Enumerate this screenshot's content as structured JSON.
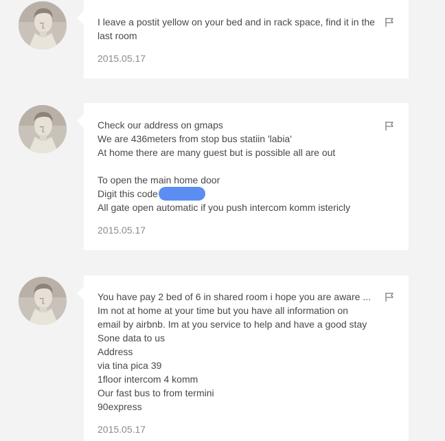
{
  "messages": [
    {
      "lines": [
        "I leave a postit yellow on your bed and in rack space, find it in the last room"
      ],
      "date": "2015.05.17",
      "flag_icon": "flag-icon",
      "avatar_icon": "avatar-david-statue"
    },
    {
      "lines": [
        "Check our address on gmaps",
        "We are 436meters from stop bus statiin 'labia'",
        "At home there are many guest but is possible all are out",
        "",
        "To open the main home door",
        "Digit this code",
        "All gate open automatic if you push intercom komm istericly"
      ],
      "date": "2015.05.17",
      "flag_icon": "flag-icon",
      "avatar_icon": "avatar-david-statue"
    },
    {
      "lines": [
        "You have pay 2 bed of 6 in shared room i hope you are aware ...",
        "Im not at home at your time but you have all information on",
        "email by airbnb. Im at you service to help and have a good stay",
        "Sone data to us",
        "Address",
        "via tina pica 39",
        "1floor intercom 4 komm",
        "Our fast bus to from termini",
        "90express"
      ],
      "date": "2015.05.17",
      "flag_icon": "flag-icon",
      "avatar_icon": "avatar-david-statue"
    }
  ],
  "colors": {
    "page_background": "#f3f3f3",
    "bubble_background": "#ffffff",
    "text": "#484848",
    "date": "#8a8a8a",
    "redaction": "#5b8ef0"
  }
}
